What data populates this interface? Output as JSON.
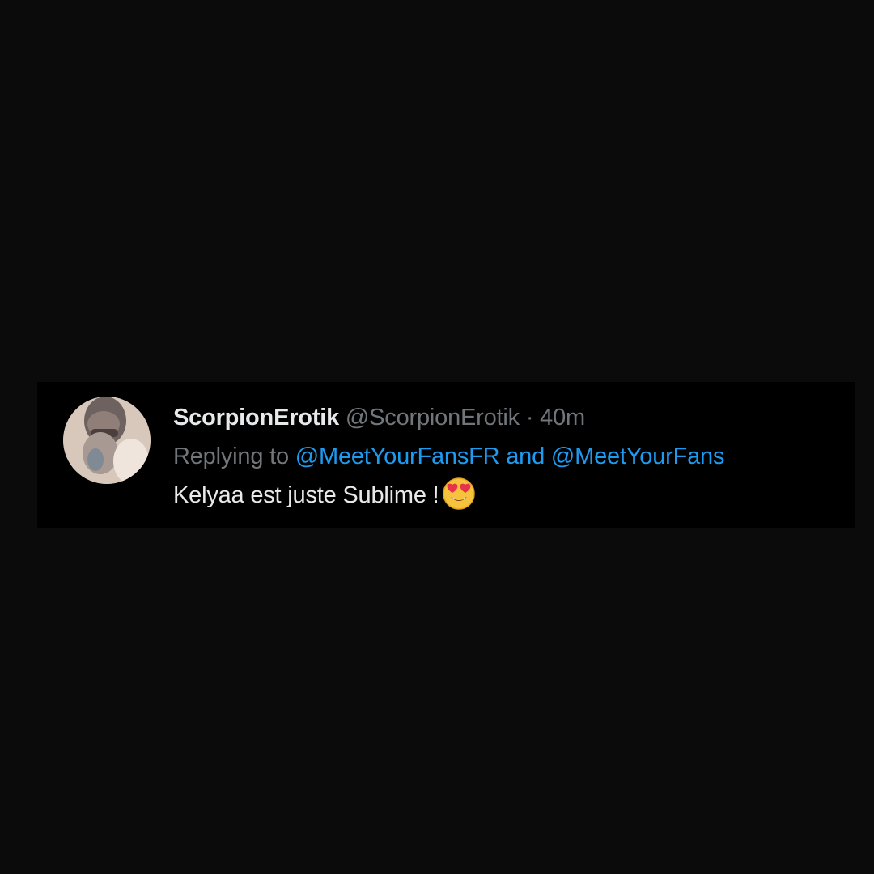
{
  "tweet": {
    "display_name": "ScorpionErotik",
    "handle": "@ScorpionErotik",
    "separator": "·",
    "time": "40m",
    "reply_prefix": "Replying to",
    "reply_mention_1": "@MeetYourFansFR",
    "reply_and": "and",
    "reply_mention_2": "@MeetYourFans",
    "text": "Kelyaa est juste Sublime !",
    "emoji": "heart-eyes-emoji"
  },
  "colors": {
    "background": "#0b0b0b",
    "card": "#000000",
    "primary_text": "#e7e9ea",
    "secondary_text": "#71767b",
    "link": "#1d9bf0"
  }
}
